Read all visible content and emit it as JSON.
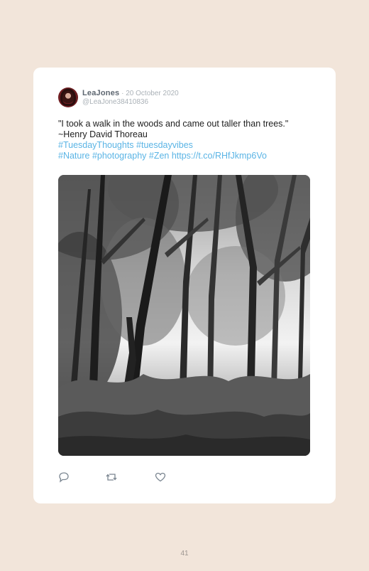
{
  "tweet": {
    "username": "LeaJones",
    "separator": " · ",
    "date": "20 October 2020",
    "handle": "@LeaJone38410836",
    "text_lines": [
      "\"I took a walk in the woods and came out taller than trees.\"",
      "~Henry David Thoreau"
    ],
    "tags_line_1": "#TuesdayThoughts #tuesdayvibes",
    "tags_line_2": "#Nature #photography #Zen https://t.co/RHfJkmp6Vo",
    "image_alt": "Black and white forest photograph"
  },
  "actions": {
    "reply_icon": "reply-icon",
    "retweet_icon": "retweet-icon",
    "like_icon": "heart-icon"
  },
  "page": {
    "number": "41"
  },
  "colors": {
    "background": "#f2e5da",
    "card": "#ffffff",
    "link": "#5ab4e5",
    "muted": "#aab1b7"
  }
}
